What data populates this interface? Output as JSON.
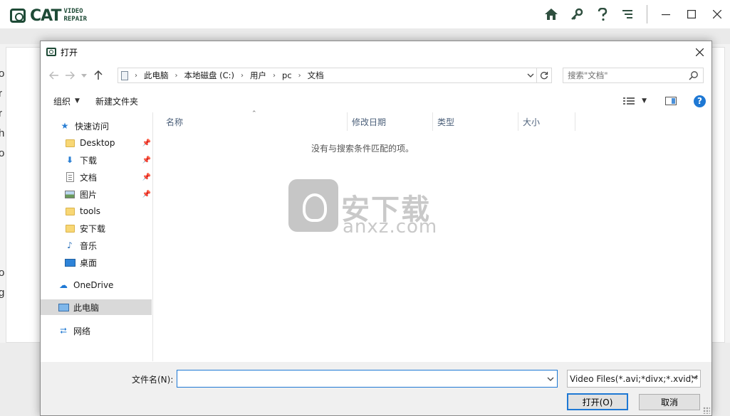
{
  "app": {
    "logo_main": "CAT",
    "logo_sub_1": "VIDEO",
    "logo_sub_2": "REPAIR",
    "icons": [
      "home-icon",
      "key-icon",
      "help-icon",
      "menu-icon"
    ],
    "side_letters": [
      "o",
      "r",
      "r",
      "h",
      "o",
      "o",
      "g"
    ]
  },
  "dialog": {
    "title": "打开",
    "breadcrumb": [
      "此电脑",
      "本地磁盘 (C:)",
      "用户",
      "pc",
      "文档"
    ],
    "search_placeholder": "搜索\"文档\"",
    "toolbar": {
      "organize_label": "组织",
      "new_folder_label": "新建文件夹"
    },
    "nav_pane": {
      "quick_access": "快速访问",
      "items": [
        {
          "label": "Desktop",
          "icon": "folder-icon",
          "pinned": true
        },
        {
          "label": "下载",
          "icon": "download-icon",
          "pinned": true
        },
        {
          "label": "文档",
          "icon": "document-icon",
          "pinned": true
        },
        {
          "label": "图片",
          "icon": "picture-icon",
          "pinned": true
        },
        {
          "label": "tools",
          "icon": "folder-icon",
          "pinned": false
        },
        {
          "label": "安下载",
          "icon": "folder-icon",
          "pinned": false
        },
        {
          "label": "音乐",
          "icon": "music-icon",
          "pinned": false
        },
        {
          "label": "桌面",
          "icon": "desktop-icon",
          "pinned": false
        }
      ],
      "onedrive": "OneDrive",
      "this_pc": "此电脑",
      "network": "网络"
    },
    "columns": [
      "名称",
      "修改日期",
      "类型",
      "大小"
    ],
    "empty_message": "没有与搜索条件匹配的项。",
    "watermark": {
      "text": "安下载",
      "domain": "anxz.com"
    },
    "filename_label": "文件名(N):",
    "filename_value": "",
    "filetype_value": "Video Files(*.avi;*divx;*.xvid;*",
    "open_button": "打开(O)",
    "cancel_button": "取消"
  },
  "colors": {
    "accent": "#1e78d4",
    "brand": "#1e4a36"
  }
}
